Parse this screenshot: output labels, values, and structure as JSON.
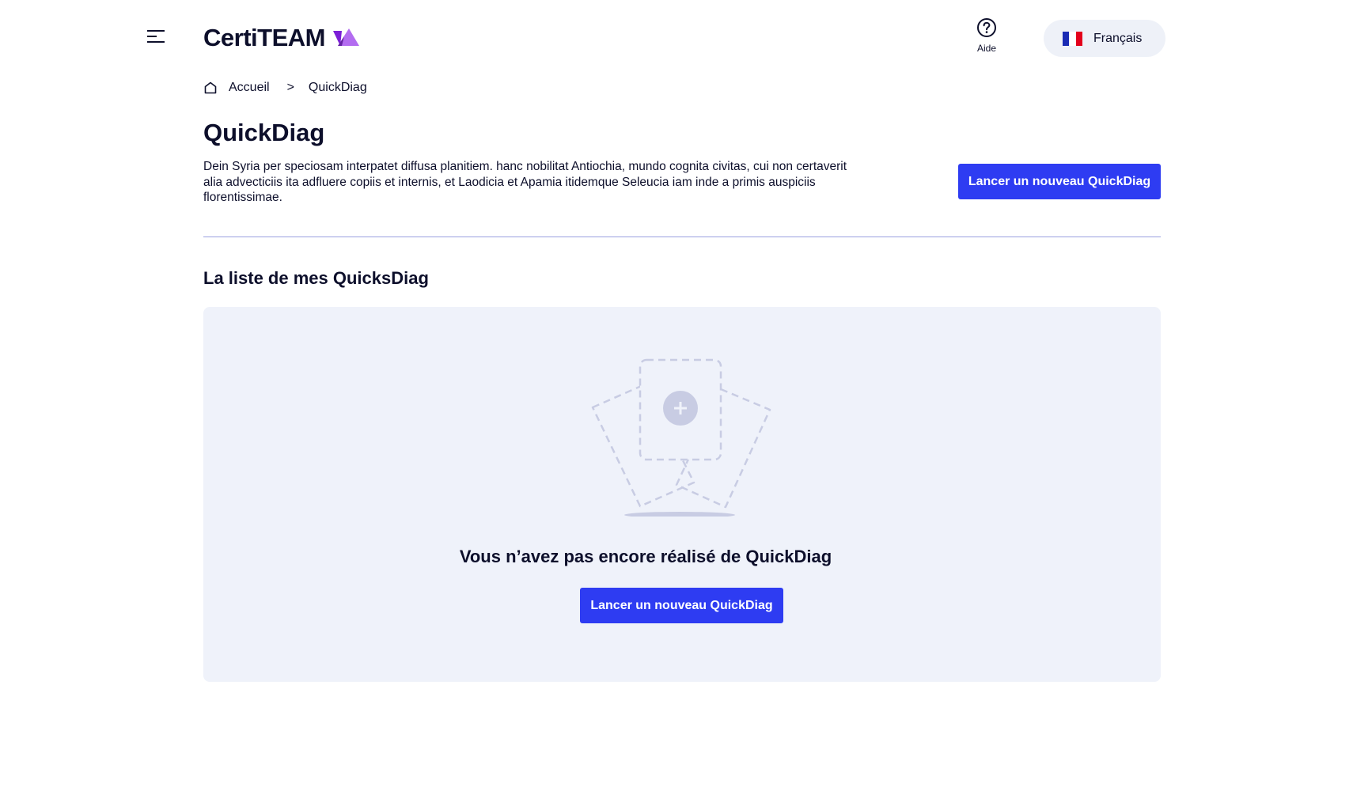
{
  "header": {
    "menu_icon": "hamburger-menu-icon",
    "logo_text": "CertiTEAM",
    "help": {
      "icon": "question-circle-icon",
      "label": "Aide"
    },
    "language": {
      "flag_icon": "french-flag-icon",
      "label": "Français"
    }
  },
  "breadcrumb": {
    "home_icon": "home-icon",
    "items": [
      "Accueil",
      "QuickDiag"
    ],
    "separator": ">"
  },
  "main": {
    "title": "QuickDiag",
    "description": "Dein Syria per speciosam interpatet diffusa planitiem. hanc nobilitat Antiochia, mundo cognita civitas, cui non certaverit alia advecticiis ita adfluere copiis et internis, et Laodicia et Apamia itidemque Seleucia iam inde a primis auspiciis florentissimae.",
    "launch_button_label": "Lancer un nouveau QuickDiag"
  },
  "list_section": {
    "title": "La liste de mes QuicksDiag",
    "empty_state": {
      "illustration_icon": "empty-documents-plus-icon",
      "message": "Vous n’avez pas encore réalisé de QuickDiag",
      "button_label": "Lancer un nouveau QuickDiag"
    }
  },
  "colors": {
    "primary": "#2e3cf2",
    "text": "#0d0f2b",
    "panel_bg": "#eff2fa",
    "divider": "#9a9fe0",
    "logo_purple": "#8a2be2",
    "logo_violet": "#b36cf0"
  }
}
